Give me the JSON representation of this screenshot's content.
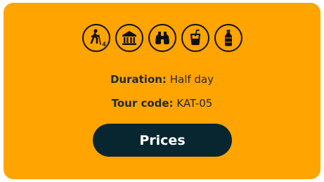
{
  "card": {
    "background_color": "#FFA400",
    "icons": [
      {
        "name": "walking-person-icon",
        "badge": "4"
      },
      {
        "name": "museum-icon"
      },
      {
        "name": "binoculars-icon"
      },
      {
        "name": "drink-cup-icon"
      },
      {
        "name": "water-bottle-icon"
      }
    ],
    "duration": {
      "label": "Duration:",
      "value": "Half day"
    },
    "tour_code": {
      "label": "Tour code:",
      "value": "KAT-05"
    },
    "prices_button": {
      "label": "Prices",
      "color": "#08262F"
    }
  }
}
